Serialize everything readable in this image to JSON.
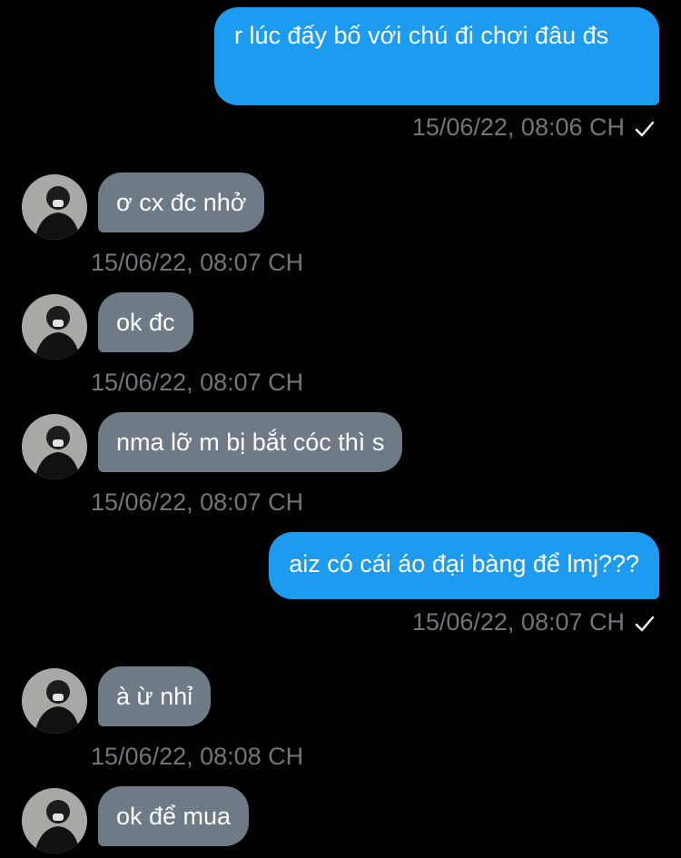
{
  "messages": [
    {
      "direction": "outgoing",
      "text": "r lúc đấy bố với chú đi chơi đâu đs",
      "timestamp": "15/06/22, 08:06 CH",
      "status_icon": "check-icon"
    },
    {
      "direction": "incoming",
      "text": "ơ cx đc nhở",
      "timestamp": "15/06/22, 08:07 CH"
    },
    {
      "direction": "incoming",
      "text": "ok đc",
      "timestamp": "15/06/22, 08:07 CH"
    },
    {
      "direction": "incoming",
      "text": "nma lỡ m bị bắt cóc thì s",
      "timestamp": "15/06/22, 08:07 CH"
    },
    {
      "direction": "outgoing",
      "text": "aiz có cái áo đại bàng để lmj???",
      "timestamp": "15/06/22, 08:07 CH",
      "status_icon": "check-icon"
    },
    {
      "direction": "incoming",
      "text": "à ừ nhỉ",
      "timestamp": "15/06/22, 08:08 CH"
    },
    {
      "direction": "incoming",
      "text": "ok để mua",
      "timestamp": ""
    }
  ],
  "colors": {
    "background": "#000000",
    "outgoing_bubble": "#1d9bf0",
    "incoming_bubble": "#6e7a86",
    "timestamp": "#71767b",
    "text": "#ffffff"
  }
}
